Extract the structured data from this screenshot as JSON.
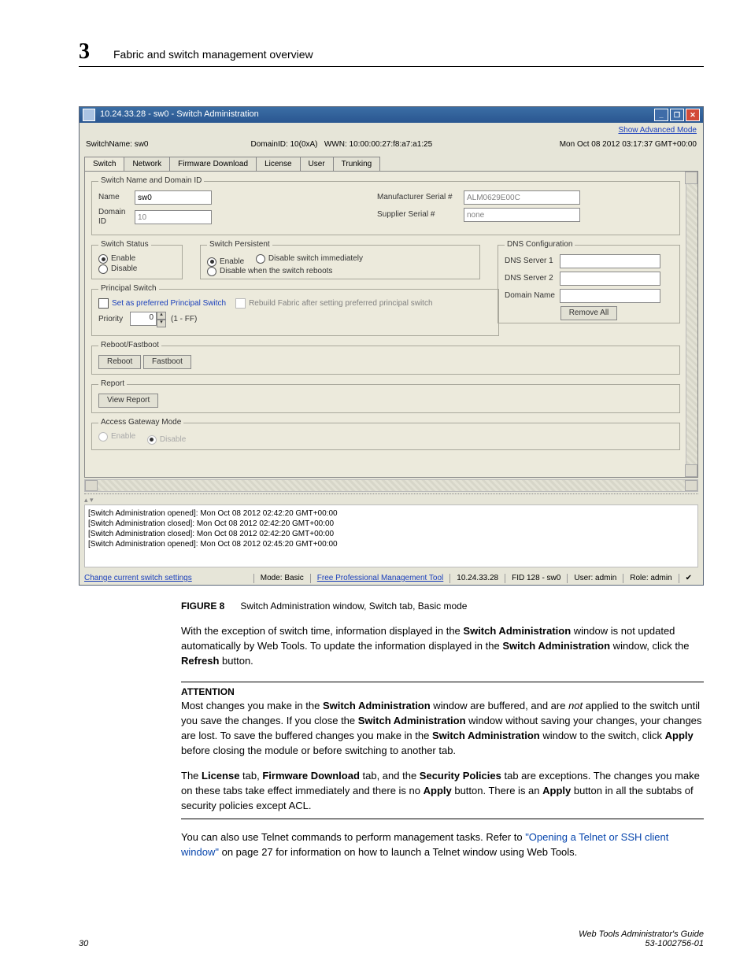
{
  "chapter": {
    "number": "3",
    "title": "Fabric and switch management overview"
  },
  "window": {
    "title": "10.24.33.28 - sw0 - Switch Administration",
    "show_advanced": "Show Advanced Mode",
    "info": {
      "switchname_label": "SwitchName:",
      "switchname_value": "sw0",
      "domainid": "DomainID: 10(0xA)",
      "wwn": "WWN: 10:00:00:27:f8:a7:a1:25",
      "timestamp": "Mon Oct 08 2012 03:17:37 GMT+00:00"
    },
    "tabs": [
      "Switch",
      "Network",
      "Firmware Download",
      "License",
      "User",
      "Trunking"
    ],
    "groups": {
      "name_id": {
        "legend": "Switch Name and Domain ID",
        "name_label": "Name",
        "name_value": "sw0",
        "domain_label": "Domain ID",
        "domain_value": "10",
        "mfr_label": "Manufacturer Serial #",
        "mfr_value": "ALM0629E00C",
        "sup_label": "Supplier Serial #",
        "sup_value": "none"
      },
      "status": {
        "legend": "Switch Status",
        "enable": "Enable",
        "disable": "Disable"
      },
      "persistent": {
        "legend": "Switch Persistent",
        "enable": "Enable",
        "imm": "Disable switch immediately",
        "reboot": "Disable when the switch reboots"
      },
      "dns": {
        "legend": "DNS Configuration",
        "s1": "DNS Server 1",
        "s2": "DNS Server 2",
        "dn": "Domain Name",
        "remove": "Remove All"
      },
      "principal": {
        "legend": "Principal Switch",
        "set": "Set as preferred Principal Switch",
        "rebuild": "Rebuild Fabric after setting preferred principal switch",
        "priority": "Priority",
        "priority_val": "0",
        "range": "(1 - FF)"
      },
      "reboot": {
        "legend": "Reboot/Fastboot",
        "reboot_btn": "Reboot",
        "fast_btn": "Fastboot"
      },
      "report": {
        "legend": "Report",
        "btn": "View Report"
      },
      "ag": {
        "legend": "Access Gateway Mode",
        "enable": "Enable",
        "disable": "Disable"
      }
    },
    "log": [
      "[Switch Administration opened]: Mon Oct 08 2012 02:42:20 GMT+00:00",
      "[Switch Administration closed]: Mon Oct 08 2012 02:42:20 GMT+00:00",
      "[Switch Administration closed]: Mon Oct 08 2012 02:42:20 GMT+00:00",
      "[Switch Administration opened]: Mon Oct 08 2012 02:45:20 GMT+00:00"
    ],
    "status": {
      "change": "Change current switch settings",
      "mode": "Mode: Basic",
      "tool": "Free Professional Management Tool",
      "ip": "10.24.33.28",
      "fid": "FID 128 - sw0",
      "user": "User: admin",
      "role": "Role: admin"
    }
  },
  "body": {
    "figure_num": "FIGURE 8",
    "figure_title": "Switch Administration window, Switch tab, Basic mode",
    "p1a": "With the exception of switch time, information displayed in the ",
    "p1b": "Switch Administration",
    "p1c": " window is not updated automatically by Web Tools. To update the information displayed in the ",
    "p1d": "Switch Administration",
    "p1e": " window, click the ",
    "p1f": "Refresh",
    "p1g": " button.",
    "attention": "ATTENTION",
    "a1a": "Most changes you make in the ",
    "a1b": "Switch Administration",
    "a1c": " window are buffered, and are ",
    "a1d": "not",
    "a1e": " applied to the switch until you save the changes. If you close the ",
    "a1f": "Switch Administration",
    "a1g": " window without saving your changes, your changes are lost. To save the buffered changes you make in the ",
    "a1h": "Switch Administration",
    "a1i": " window to the switch, click ",
    "a1j": "Apply",
    "a1k": " before closing the module or before switching to another tab.",
    "a2a": "The ",
    "a2b": "License",
    "a2c": " tab, ",
    "a2d": "Firmware Download",
    "a2e": " tab, and the ",
    "a2f": "Security Policies",
    "a2g": " tab are exceptions. The changes you make on these tabs take effect immediately and there is no ",
    "a2h": "Apply",
    "a2i": " button. There is an ",
    "a2j": "Apply",
    "a2k": " button in all the subtabs of security policies except ACL.",
    "p3a": "You can also use Telnet commands to perform management tasks. Refer to ",
    "p3b": "\"Opening a Telnet or SSH client window\"",
    "p3c": " on page 27 for information on how to launch a Telnet window using Web Tools."
  },
  "footer": {
    "page": "30",
    "title": "Web Tools Administrator's Guide",
    "docnum": "53-1002756-01"
  }
}
